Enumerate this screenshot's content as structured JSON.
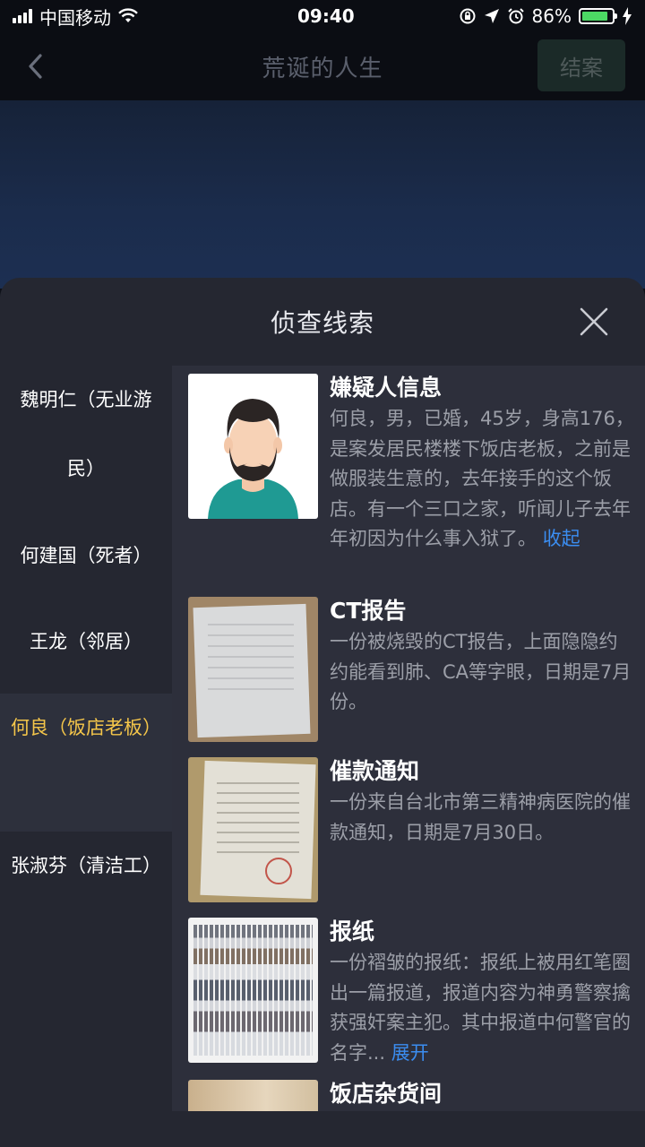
{
  "status_bar": {
    "carrier": "中国移动",
    "time": "09:40",
    "battery_percent": "86%",
    "battery_level": 0.86
  },
  "nav": {
    "title": "荒诞的人生",
    "close_case_label": "结案"
  },
  "panel": {
    "title": "侦查线索"
  },
  "sidebar": {
    "items": [
      {
        "label": "魏明仁（无业游民）",
        "active": false
      },
      {
        "label": "何建国（死者）",
        "active": false
      },
      {
        "label": "王龙（邻居）",
        "active": false
      },
      {
        "label": "何良（饭店老板）",
        "active": true
      },
      {
        "label": "张淑芬（清洁工）",
        "active": false
      }
    ]
  },
  "clues": [
    {
      "title": "嫌疑人信息",
      "desc": "何良，男，已婚，45岁，身高176，是案发居民楼楼下饭店老板，之前是做服装生意的，去年接手的这个饭店。有一个三口之家，听闻儿子去年年初因为什么事入狱了。",
      "link": "收起",
      "thumb": "avatar-icon"
    },
    {
      "title": "CT报告",
      "desc": "一份被烧毁的CT报告，上面隐隐约约能看到肺、CA等字眼，日期是7月份。",
      "thumb": "ct-report-photo"
    },
    {
      "title": "催款通知",
      "desc": "一份来自台北市第三精神病医院的催款通知，日期是7月30日。",
      "thumb": "payment-notice-photo"
    },
    {
      "title": "报纸",
      "desc": "一份褶皱的报纸：报纸上被用红笔圈出一篇报道，报道内容为神勇警察擒获强奸案主犯。其中报道中何警官的名字...",
      "link": "展开",
      "thumb": "newspaper-photo"
    },
    {
      "title": "饭店杂货间",
      "thumb": "storeroom-photo"
    }
  ],
  "colors": {
    "accent_active": "#f5c64a",
    "link": "#3b8df0",
    "battery": "#4cd964"
  }
}
